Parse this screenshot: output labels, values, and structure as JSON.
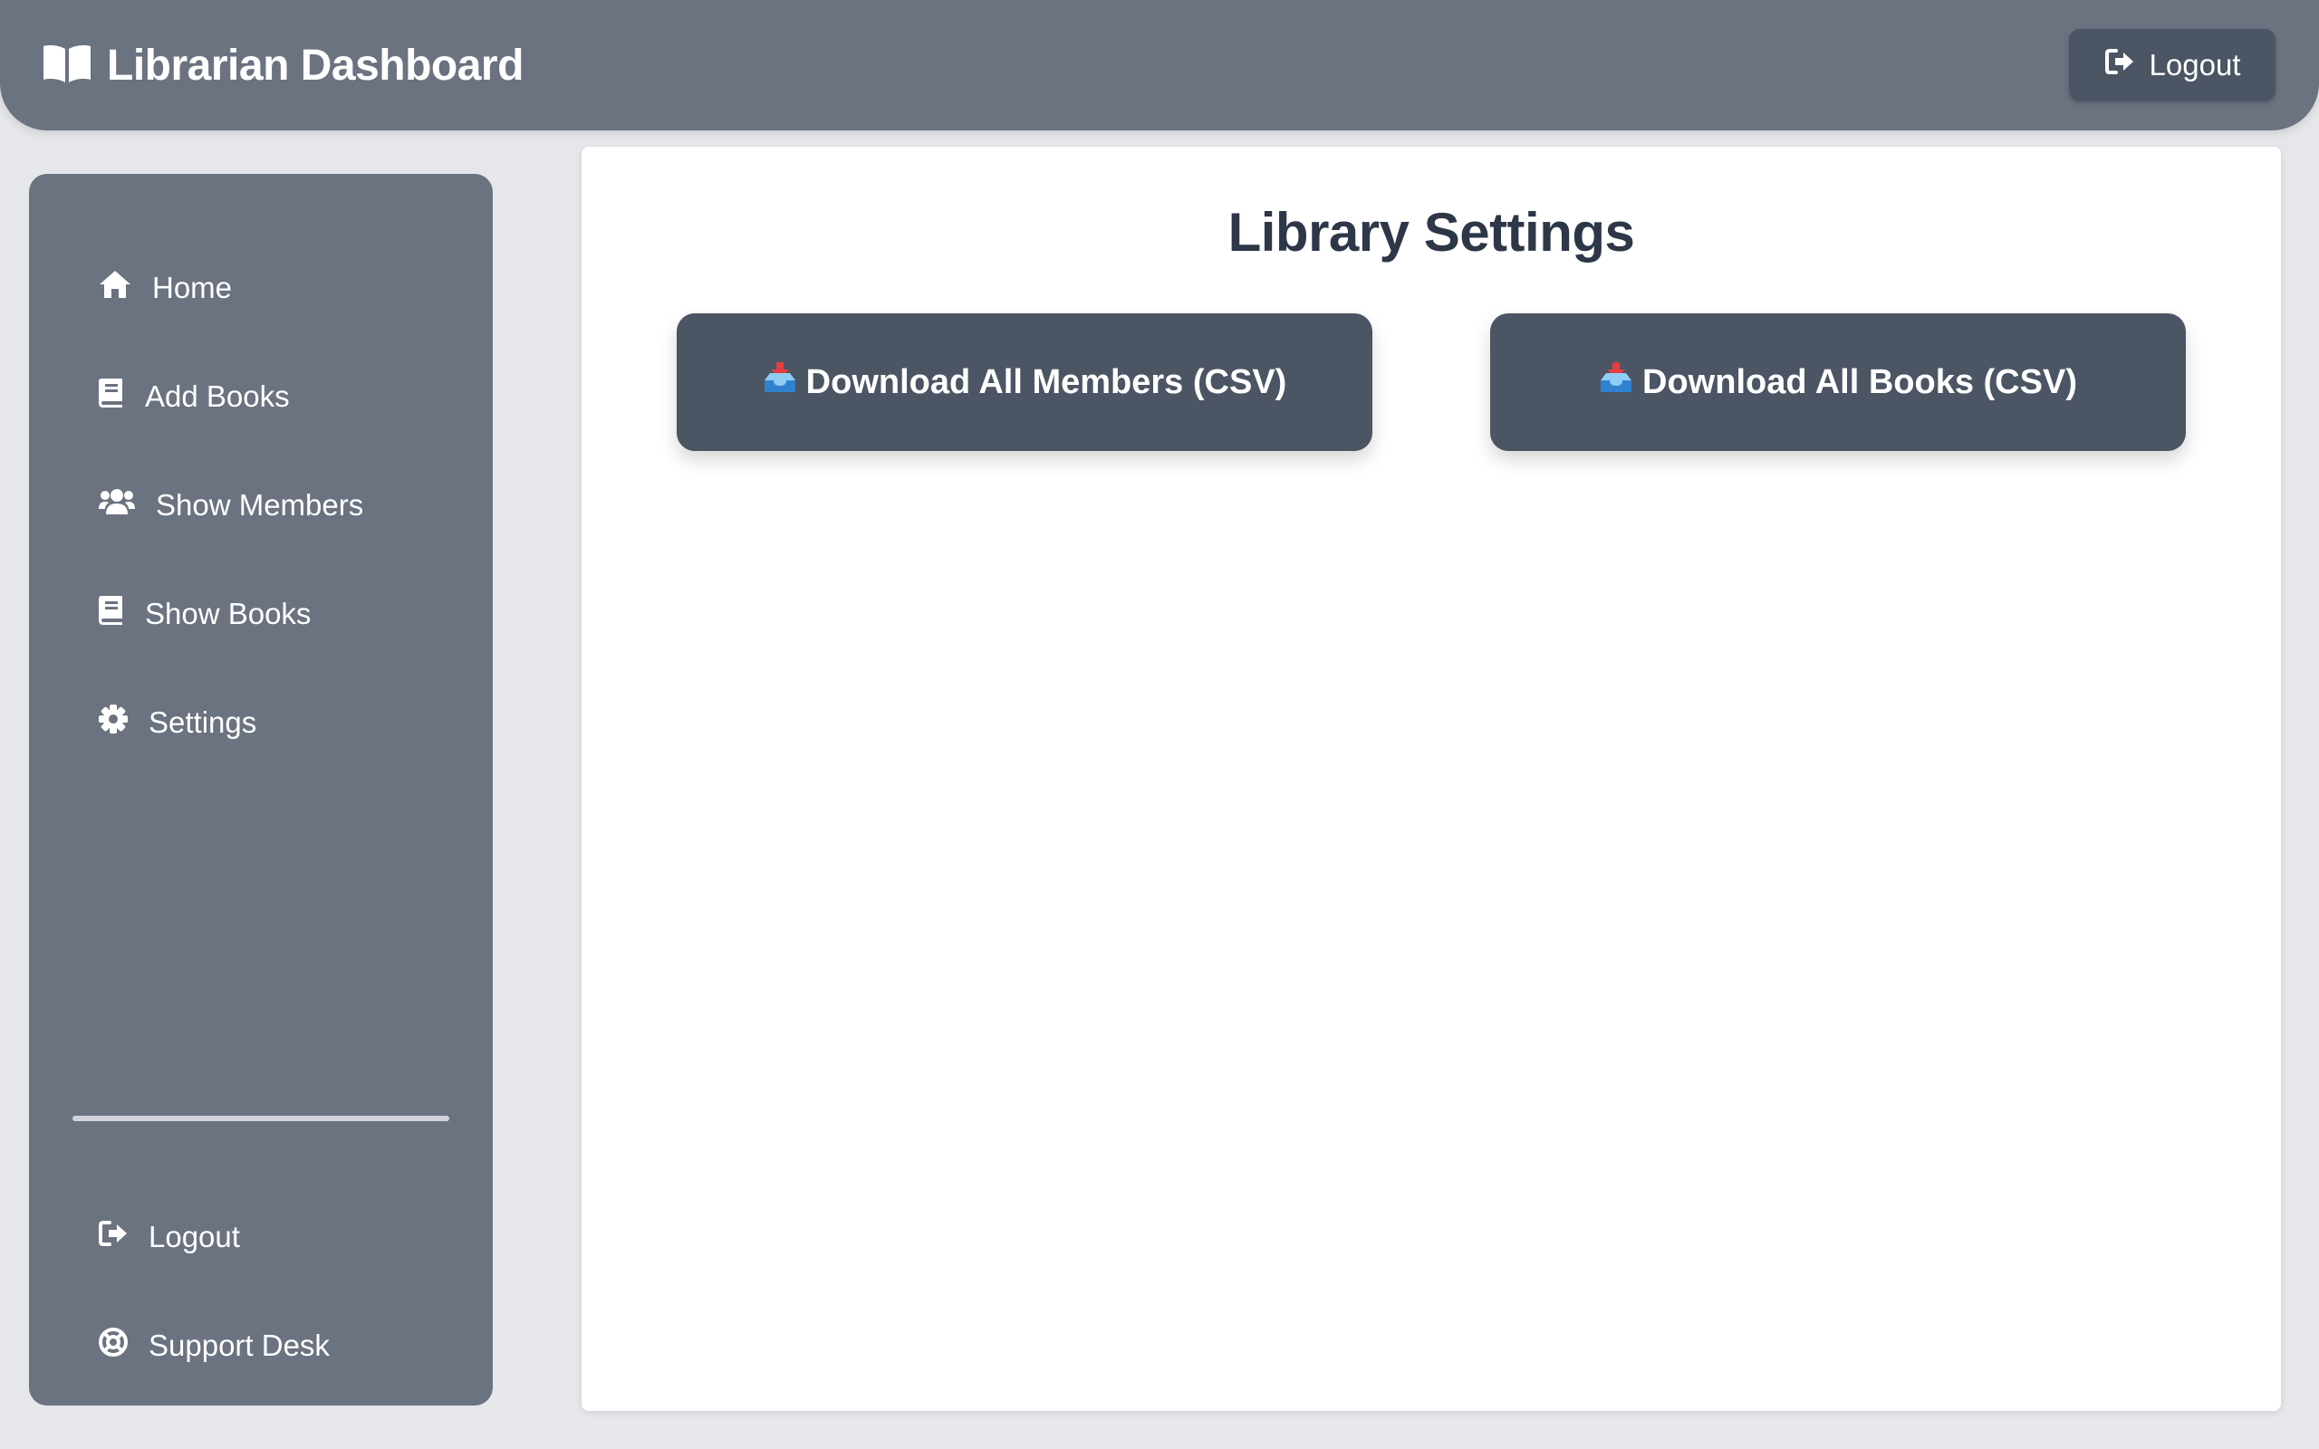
{
  "header": {
    "title": "Librarian Dashboard",
    "logout_label": "Logout"
  },
  "sidebar": {
    "items": [
      {
        "label": "Home",
        "icon": "home-icon"
      },
      {
        "label": "Add Books",
        "icon": "book-icon"
      },
      {
        "label": "Show Members",
        "icon": "users-icon"
      },
      {
        "label": "Show Books",
        "icon": "book-icon"
      },
      {
        "label": "Settings",
        "icon": "gear-icon"
      }
    ],
    "bottom_items": [
      {
        "label": "Logout",
        "icon": "logout-icon"
      },
      {
        "label": "Support Desk",
        "icon": "lifebuoy-icon"
      }
    ]
  },
  "main": {
    "title": "Library Settings",
    "buttons": [
      {
        "label": "Download All Members (CSV)",
        "icon": "inbox-tray-icon"
      },
      {
        "label": "Download All Books (CSV)",
        "icon": "inbox-tray-icon"
      }
    ]
  },
  "colors": {
    "page_bg": "#e5e7eb",
    "header_bg": "#6b7280",
    "sidebar_bg": "#6b7280",
    "button_bg": "#4b5563",
    "title_text": "#2d3748"
  }
}
